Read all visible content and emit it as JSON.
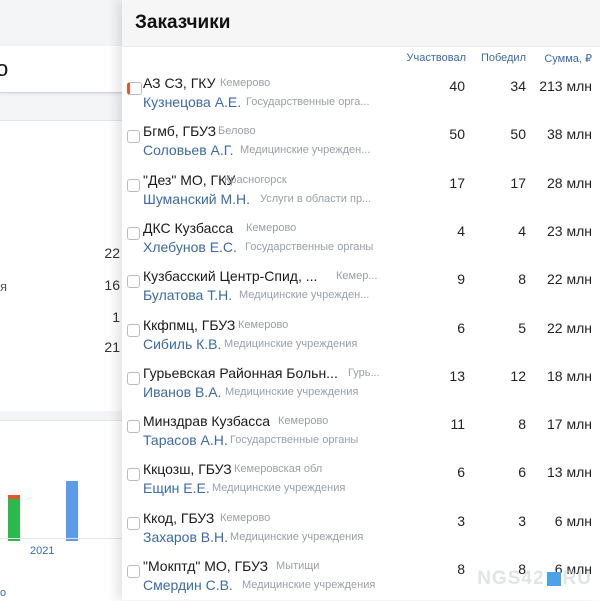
{
  "background": {
    "search_fragment": "o",
    "values": [
      "22",
      "16",
      "1",
      "21"
    ],
    "edge_text": "я",
    "chart_year": "2021",
    "bottom_text": "о",
    "bar_colors": [
      "#2db84d",
      "#e2572b",
      "#5b9be8"
    ]
  },
  "panel": {
    "title": "Заказчики",
    "columns": {
      "participated": "Участвовал",
      "won": "Победил",
      "sum": "Сумма, ₽"
    },
    "rows": [
      {
        "name": "АЗ СЗ, ГКУ",
        "location": "Кемерово",
        "person": "Кузнецова А.Е.",
        "sector": "Государственные орга...",
        "participated": "40",
        "won": "34",
        "sum": "213 млн"
      },
      {
        "name": "Бгмб, ГБУЗ",
        "location": "Белово",
        "person": "Соловьев А.Г.",
        "sector": "Медицинские учрежден...",
        "participated": "50",
        "won": "50",
        "sum": "38 млн"
      },
      {
        "name": "\"Дез\" МО, ГКУ",
        "location": "Красногорск",
        "person": "Шуманский М.Н.",
        "sector": "Услуги в области пр...",
        "participated": "17",
        "won": "17",
        "sum": "28 млн"
      },
      {
        "name": "ДКС Кузбасса",
        "location": "Кемерово",
        "person": "Хлебунов Е.С.",
        "sector": "Государственные органы",
        "participated": "4",
        "won": "4",
        "sum": "23 млн"
      },
      {
        "name": "Кузбасский Центр-Спид, ...",
        "location": "Кемер...",
        "person": "Булатова Т.Н.",
        "sector": "Медицинские учрежден...",
        "participated": "9",
        "won": "8",
        "sum": "22 млн"
      },
      {
        "name": "Ккфпмц, ГБУЗ",
        "location": "Кемерово",
        "person": "Сибиль К.В.",
        "sector": "Медицинские учреждения",
        "participated": "6",
        "won": "5",
        "sum": "22 млн"
      },
      {
        "name": "Гурьевская Районная Больн...",
        "location": "Гурь...",
        "person": "Иванов В.А.",
        "sector": "Медицинские учреждения",
        "participated": "13",
        "won": "12",
        "sum": "18 млн"
      },
      {
        "name": "Минздрав Кузбасса",
        "location": "Кемерово",
        "person": "Тарасов А.Н.",
        "sector": "Государственные органы",
        "participated": "11",
        "won": "8",
        "sum": "17 млн"
      },
      {
        "name": "Ккцозш, ГБУЗ",
        "location": "Кемеровская обл",
        "person": "Ещин Е.Е.",
        "sector": "Медицинские учреждения",
        "participated": "6",
        "won": "6",
        "sum": "13 млн"
      },
      {
        "name": "Ккод, ГБУЗ",
        "location": "Кемерово",
        "person": "Захаров В.Н.",
        "sector": "Медицинские учреждения",
        "participated": "3",
        "won": "3",
        "sum": "6 млн"
      },
      {
        "name": "\"Мокптд\" МО, ГБУЗ",
        "location": "Мытищи",
        "person": "Смердин С.В.",
        "sector": "Медицинские учреждения",
        "participated": "8",
        "won": "8",
        "sum": "6 млн"
      }
    ]
  },
  "watermark": {
    "left": "NGS42",
    "right": "RU",
    "accent": "#4aa3e8"
  }
}
